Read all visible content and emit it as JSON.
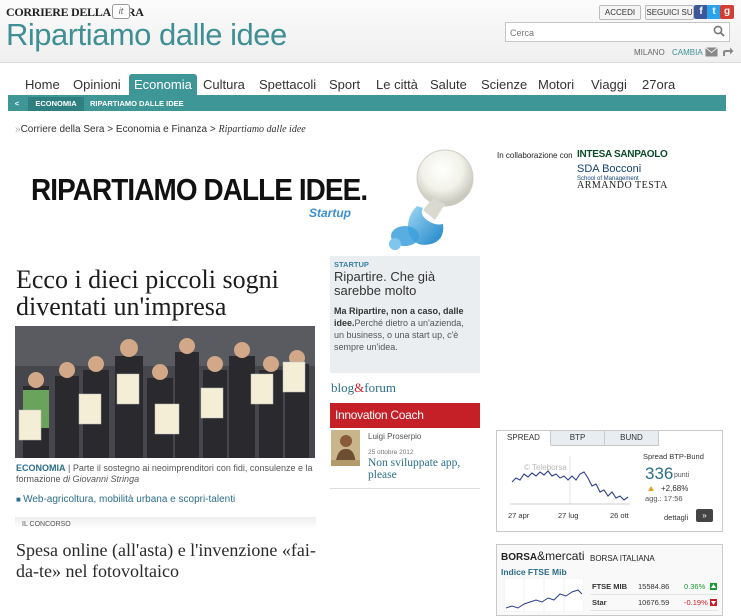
{
  "header": {
    "brand": "CORRIERE DELLA SERA",
    "brand_mark": "it",
    "section_title": "Ripartiamo dalle idee",
    "login_label": "ACCEDI",
    "follow_label": "SEGUICI SU",
    "search_placeholder": "Cerca",
    "city": "MILANO",
    "city_change": "CAMBIA"
  },
  "nav": {
    "items": [
      "Home",
      "Opinioni",
      "Economia",
      "Cultura",
      "Spettacoli",
      "Sport",
      "Le città",
      "Salute",
      "Scienze",
      "Motori",
      "Viaggi",
      "27ora"
    ],
    "active": "Economia",
    "sub": {
      "back": "<",
      "current": "ECONOMIA",
      "page": "RIPARTIAMO DALLE IDEE"
    }
  },
  "breadcrumb": {
    "root": "Corriere della Sera",
    "section": "Economia e Finanza",
    "page": "Ripartiamo dalle idee"
  },
  "banner": {
    "title": "RIPARTIAMO DALLE IDEE.",
    "subtitle": "Startup",
    "collab_label": "In collaborazione con",
    "partners": {
      "intesa": "INTESA SANPAOLO",
      "sda": "SDA Bocconi",
      "sda_sub": "School of Management",
      "armando": "ARMANDO TESTA"
    }
  },
  "main_story": {
    "headline": "Ecco i dieci piccoli sogni diventati un'impresa",
    "category": "ECONOMIA",
    "summary": " | Parte il sostegno ai neoimprenditori con fidi, consulenze e la formazione ",
    "author": "di Giovanni Stringa",
    "related": "Web-agricoltura, mobilità urbana e scopri-talenti"
  },
  "second_story": {
    "kicker": "IL CONCORSO",
    "headline": "Spesa online (all'asta) e l'invenzione «fai-da-te» nel fotovoltaico"
  },
  "startup_box": {
    "label": "STARTUP",
    "title": "Ripartire. Che già sarebbe molto",
    "lead": "Ma Ripartire, non a caso, dalle idee.",
    "text": "Perché dietro a un'azienda, un business, o una start up, c'è sempre un'idea."
  },
  "blog": {
    "blog": "blog",
    "amp": "&",
    "forum": "forum"
  },
  "coach": {
    "bar_title": "Innovation Coach",
    "author": "Luigi Proserpio",
    "date": "25 ottobre 2012",
    "title": "Non sviluppate app, please"
  },
  "spread_widget": {
    "tabs": [
      "SPREAD",
      "BTP",
      "BUND"
    ],
    "active_tab": "SPREAD",
    "label": "Spread BTP-Bund",
    "value": "336",
    "unit": "punti",
    "change": "+2,68%",
    "time": "agg.: 17:56",
    "details": "dettagli",
    "details_btn": "»",
    "watermark": "© Teleborsa",
    "x_labels": [
      "27 apr",
      "27 lug",
      "26 ott"
    ]
  },
  "borsa": {
    "title_main": "BORSA",
    "title_amp": "&",
    "title_rest": "mercati",
    "market": "BORSA ITALIANA",
    "index_label": "Indice FTSE Mib",
    "rows": [
      {
        "name": "FTSE MIB",
        "value": "15584.86",
        "change": "0.36%",
        "color": "#1a9a32",
        "dir": "up"
      },
      {
        "name": "Star",
        "value": "10676.59",
        "change": "-0.19%",
        "color": "#c51f27",
        "dir": "down"
      }
    ]
  },
  "colors": {
    "accent": "#3f9697",
    "coach_red": "#c51f27",
    "link_blue": "#2b6e88"
  }
}
